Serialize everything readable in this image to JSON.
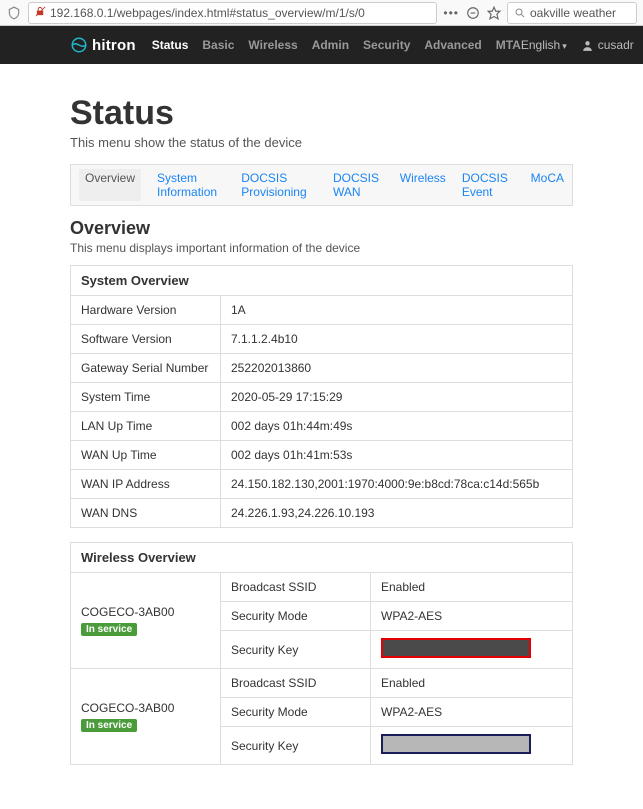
{
  "browser": {
    "url": "192.168.0.1/webpages/index.html#status_overview/m/1/s/0",
    "search_value": "oakville weather"
  },
  "topnav": {
    "brand": "hitron",
    "items": [
      "Status",
      "Basic",
      "Wireless",
      "Admin",
      "Security",
      "Advanced",
      "MTA"
    ],
    "active_index": 0,
    "language": "English",
    "user": "cusadr"
  },
  "page": {
    "title": "Status",
    "subtitle": "This menu show the status of the device"
  },
  "tabs": {
    "items": [
      "Overview",
      "System Information",
      "DOCSIS Provisioning",
      "DOCSIS WAN",
      "Wireless",
      "DOCSIS Event",
      "MoCA"
    ],
    "active_index": 0
  },
  "overview": {
    "title": "Overview",
    "subtitle": "This menu displays important information of the device"
  },
  "system_overview": {
    "header": "System Overview",
    "rows": [
      {
        "label": "Hardware Version",
        "value": "1A"
      },
      {
        "label": "Software Version",
        "value": "7.1.1.2.4b10"
      },
      {
        "label": "Gateway Serial Number",
        "value": "252202013860"
      },
      {
        "label": "System Time",
        "value": "2020-05-29 17:15:29"
      },
      {
        "label": "LAN Up Time",
        "value": "002 days 01h:44m:49s"
      },
      {
        "label": "WAN Up Time",
        "value": "002 days 01h:41m:53s"
      },
      {
        "label": "WAN IP Address",
        "value": "24.150.182.130,2001:1970:4000:9e:b8cd:78ca:c14d:565b"
      },
      {
        "label": "WAN DNS",
        "value": "24.226.1.93,24.226.10.193"
      }
    ]
  },
  "wireless_overview": {
    "header": "Wireless Overview",
    "col_labels": {
      "bcast": "Broadcast SSID",
      "mode": "Security Mode",
      "key": "Security Key"
    },
    "networks": [
      {
        "ssid": "COGECO-3AB00",
        "status": "In service",
        "broadcast_ssid": "Enabled",
        "security_mode": "WPA2-AES",
        "key_redaction": "red"
      },
      {
        "ssid": "COGECO-3AB00",
        "status": "In service",
        "broadcast_ssid": "Enabled",
        "security_mode": "WPA2-AES",
        "key_redaction": "navy"
      }
    ]
  }
}
